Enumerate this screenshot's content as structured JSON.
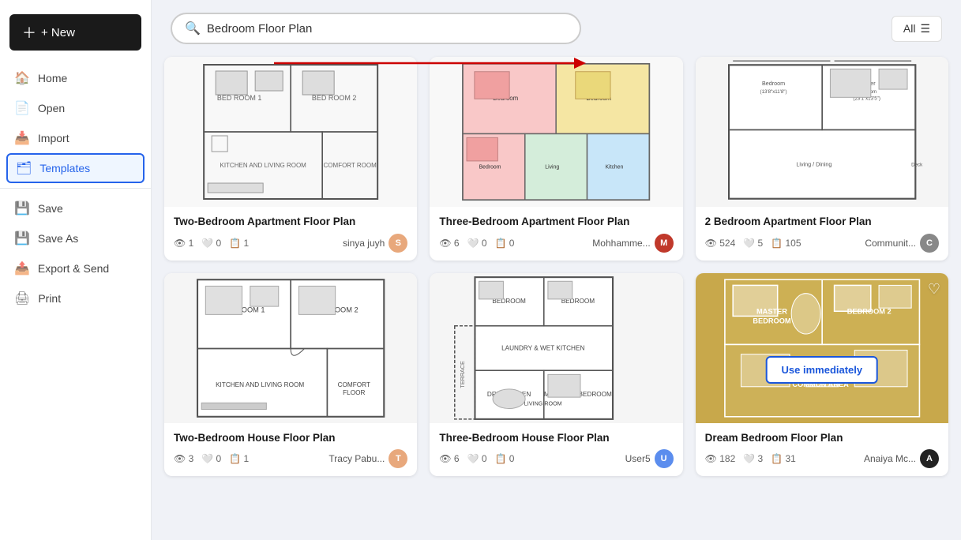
{
  "sidebar": {
    "new_label": "+ New",
    "items": [
      {
        "id": "home",
        "label": "Home",
        "icon": "🏠"
      },
      {
        "id": "open",
        "label": "Open",
        "icon": "📄"
      },
      {
        "id": "import",
        "label": "Import",
        "icon": "📥"
      },
      {
        "id": "templates",
        "label": "Templates",
        "icon": "🗂",
        "active": true
      },
      {
        "id": "save",
        "label": "Save",
        "icon": "💾"
      },
      {
        "id": "save-as",
        "label": "Save As",
        "icon": "💾"
      },
      {
        "id": "export",
        "label": "Export & Send",
        "icon": "📤"
      },
      {
        "id": "print",
        "label": "Print",
        "icon": "🖨"
      }
    ]
  },
  "search": {
    "placeholder": "Bedroom Floor Plan",
    "value": "Bedroom Floor Plan"
  },
  "filter": {
    "label": "All",
    "icon": "☰"
  },
  "cards": [
    {
      "id": "card1",
      "title": "Two-Bedroom Apartment Floor Plan",
      "views": 1,
      "likes": 0,
      "copies": 1,
      "author": "sinya juyh",
      "avatar_color": "#e8a87c",
      "bg": "#f5f5f5"
    },
    {
      "id": "card2",
      "title": "Three-Bedroom Apartment Floor Plan",
      "views": 6,
      "likes": 0,
      "copies": 0,
      "author": "Mohhamme...",
      "avatar_color": "#c0392b",
      "avatar_letter": "M",
      "bg": "#f5f5f5"
    },
    {
      "id": "card3",
      "title": "2 Bedroom Apartment Floor Plan",
      "views": 524,
      "likes": 5,
      "copies": 105,
      "author": "Communit...",
      "avatar_color": "#888",
      "bg": "#f5f5f5"
    },
    {
      "id": "card4",
      "title": "Two-Bedroom House Floor Plan",
      "views": 3,
      "likes": 0,
      "copies": 1,
      "author": "Tracy Pabu...",
      "avatar_color": "#e8a87c",
      "bg": "#f5f5f5"
    },
    {
      "id": "card5",
      "title": "Three-Bedroom House Floor Plan",
      "views": 6,
      "likes": 0,
      "copies": 0,
      "author": "User5",
      "avatar_color": "#5b8dee",
      "bg": "#f5f5f5"
    },
    {
      "id": "card6",
      "title": "Dream Bedroom Floor Plan",
      "views": 182,
      "likes": 3,
      "copies": 31,
      "author": "Anaiya Mc...",
      "avatar_color": "#222",
      "avatar_letter": "A",
      "bg": "#c8a84b",
      "use_immediately": true,
      "has_heart": true
    }
  ],
  "buttons": {
    "new": "+ New",
    "use_immediately": "Use immediately"
  }
}
